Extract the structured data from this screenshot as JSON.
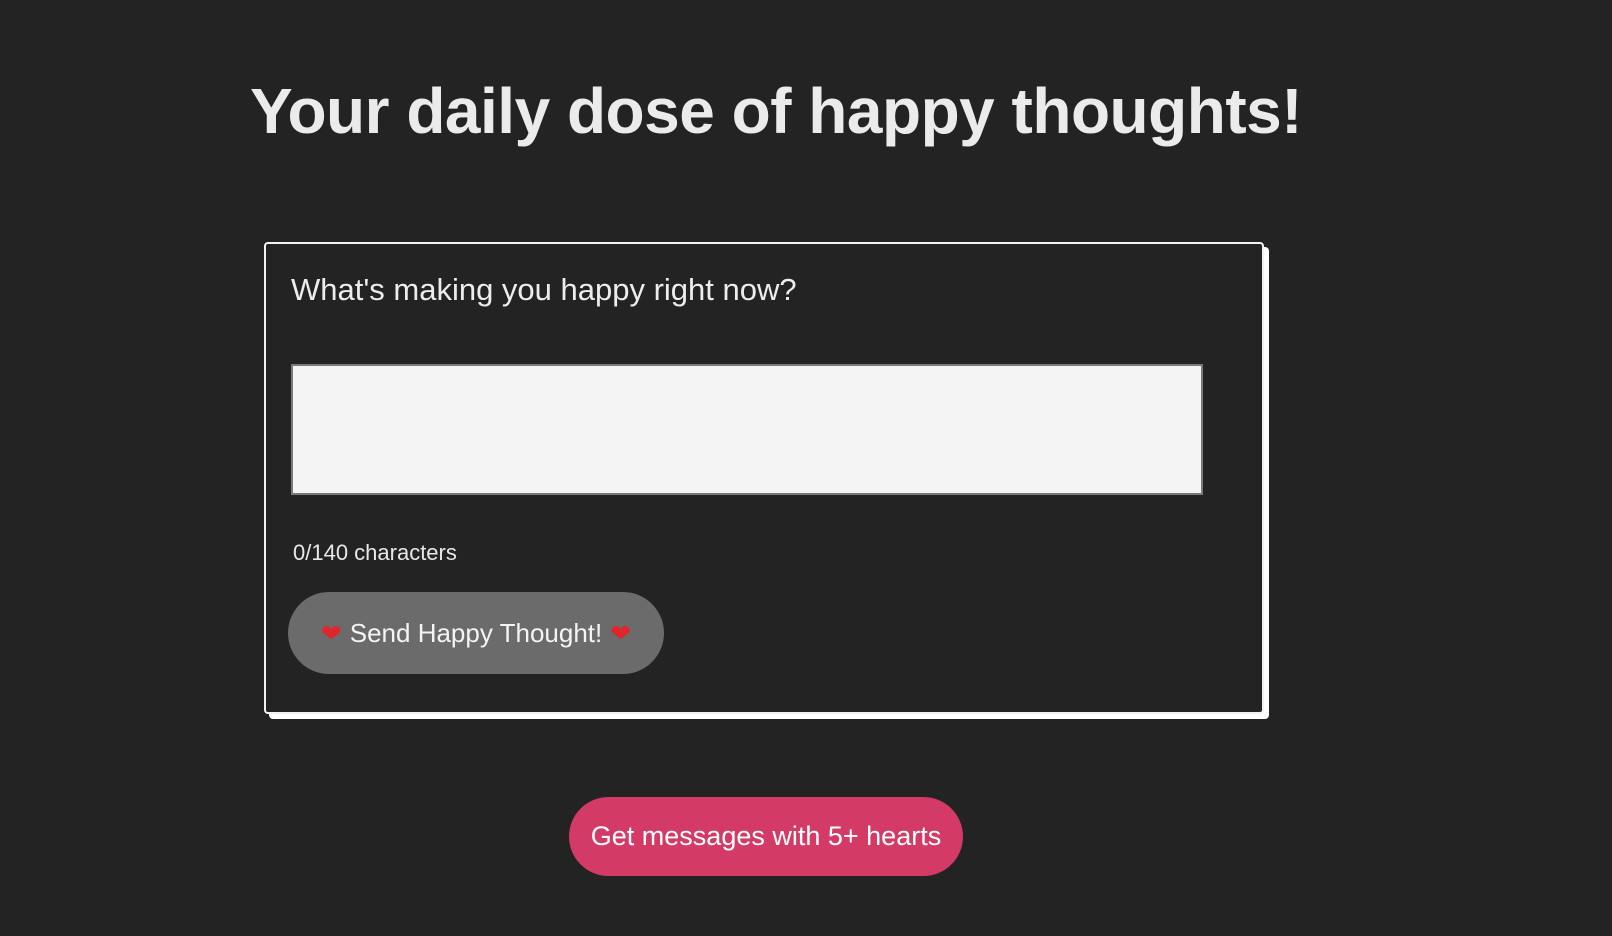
{
  "header": {
    "title": "Your daily dose of happy thoughts!"
  },
  "form": {
    "prompt": "What's making you happy right now?",
    "input_value": "",
    "input_placeholder": "",
    "char_count": "0/140 characters",
    "send_button": {
      "label": "Send Happy Thought!",
      "icon_left": "heart-icon",
      "icon_right": "heart-icon",
      "glyph": "❤"
    }
  },
  "filter_button": {
    "label": "Get messages with 5+ hearts"
  },
  "colors": {
    "background": "#232323",
    "send_button": "#6b6b6b",
    "filter_button": "#d43a66",
    "heart": "#e0262d"
  }
}
